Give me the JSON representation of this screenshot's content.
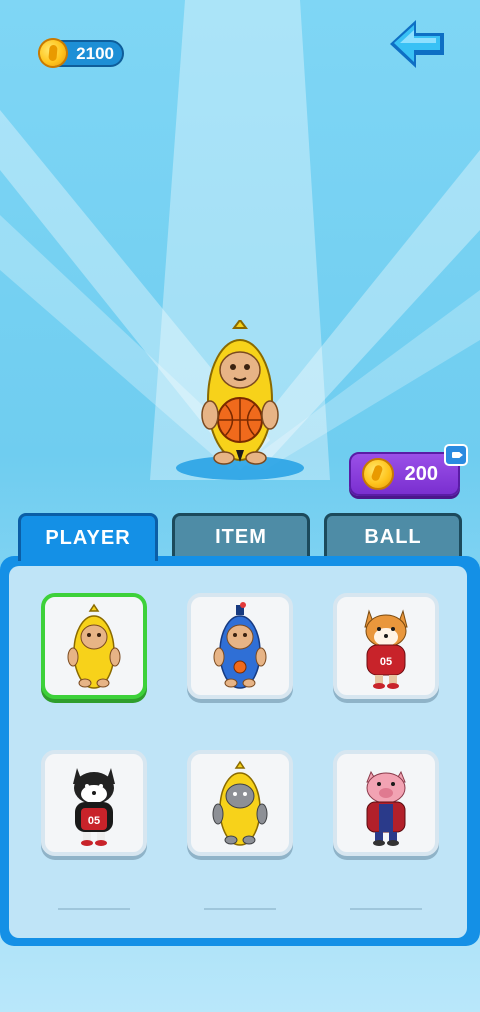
{
  "hud": {
    "coins": "2100",
    "coin_icon": "coin-icon",
    "back_icon": "back-arrow-icon"
  },
  "preview": {
    "character": "banana-cat",
    "price": "200",
    "price_icon": "coin-icon",
    "ad_icon": "video-ad-icon"
  },
  "tabs": [
    {
      "label": "PLAYER",
      "active": true
    },
    {
      "label": "ITEM",
      "active": false
    },
    {
      "label": "BALL",
      "active": false
    }
  ],
  "characters": [
    {
      "name": "banana-cat",
      "selected": true
    },
    {
      "name": "blue-bottle-cat",
      "selected": false
    },
    {
      "name": "shiba-dog",
      "jersey": "05",
      "selected": false
    },
    {
      "name": "husky-dog",
      "jersey": "05",
      "selected": false
    },
    {
      "name": "banana-gray-cat",
      "selected": false
    },
    {
      "name": "pig",
      "selected": false
    }
  ],
  "colors": {
    "accent": "#1490e6",
    "selected": "#3dd13a",
    "price_button": "#8a3fe0"
  }
}
